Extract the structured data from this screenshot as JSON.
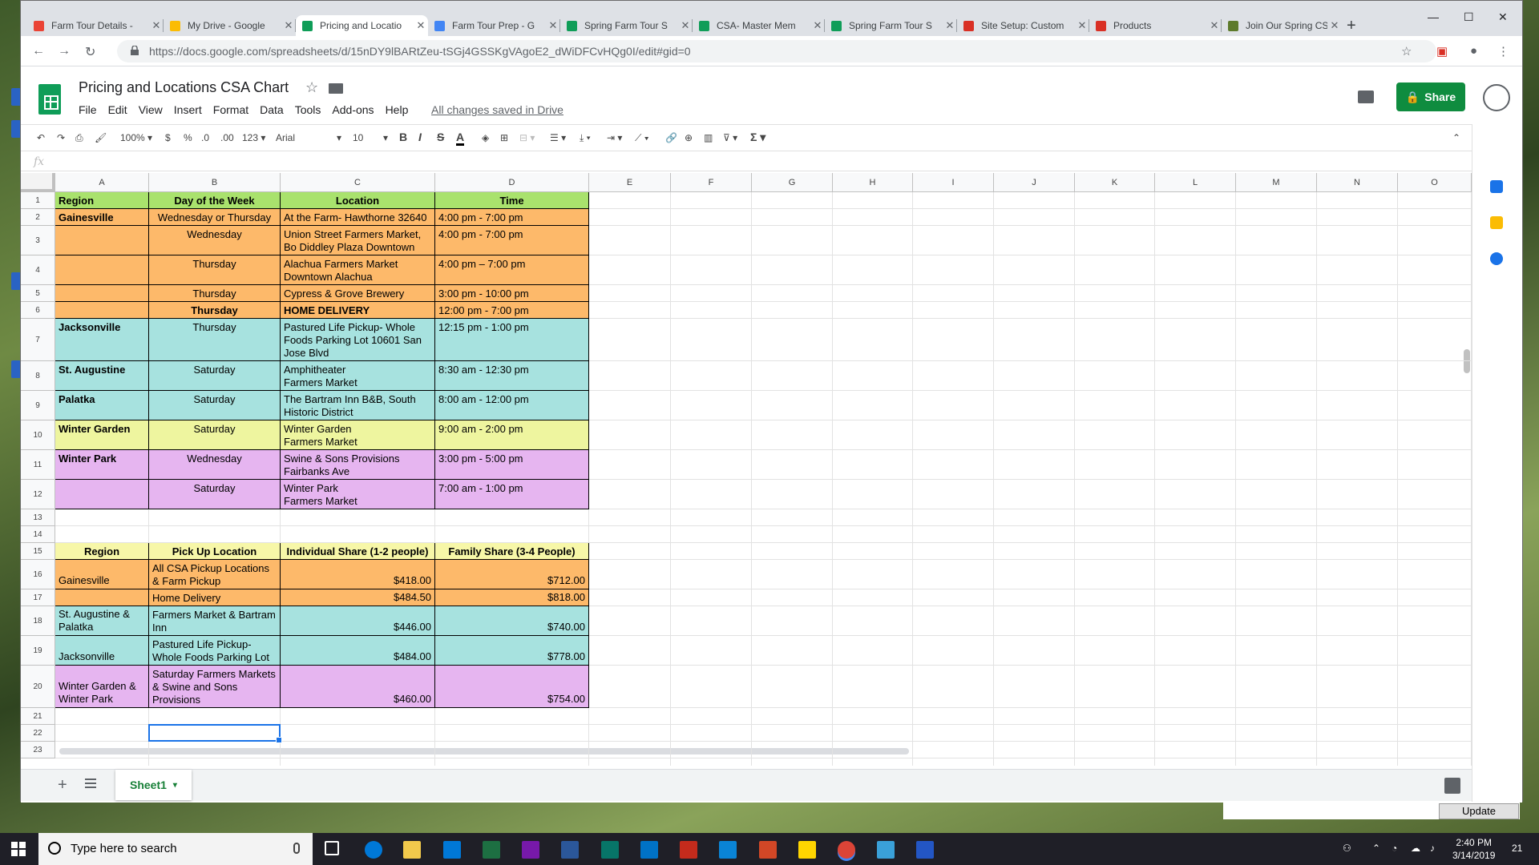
{
  "browser": {
    "tabs": [
      {
        "label": "Farm Tour Details - ",
        "icon_color": "#ea4335",
        "left": 0
      },
      {
        "label": "My Drive - Google",
        "icon_color": "#fbbc04"
      },
      {
        "label": "Pricing and Locatio",
        "icon_color": "#0f9d58",
        "active": true
      },
      {
        "label": "Farm Tour Prep - G",
        "icon_color": "#4285f4"
      },
      {
        "label": "Spring Farm Tour S",
        "icon_color": "#0f9d58"
      },
      {
        "label": "CSA- Master Mem",
        "icon_color": "#0f9d58"
      },
      {
        "label": "Spring Farm Tour S",
        "icon_color": "#0f9d58"
      },
      {
        "label": "Site Setup: Custom",
        "icon_color": "#d93025"
      },
      {
        "label": "Products",
        "icon_color": "#d93025"
      },
      {
        "label": "Join Our Spring CS",
        "icon_color": "#5d7a2b"
      }
    ],
    "url": "https://docs.google.com/spreadsheets/d/15nDY9lBARtZeu-tSGj4GSSKgVAgoE2_dWiDFCvHQg0I/edit#gid=0"
  },
  "app": {
    "title": "Pricing and Locations CSA Chart",
    "menus": [
      "File",
      "Edit",
      "View",
      "Insert",
      "Format",
      "Data",
      "Tools",
      "Add-ons",
      "Help"
    ],
    "saved_status": "All changes saved in Drive",
    "share_label": "Share"
  },
  "toolbar": {
    "zoom": "100%",
    "currency": "$",
    "percent": "%",
    "dec_less": ".0",
    "dec_more": ".00",
    "more_formats": "123",
    "font": "Arial",
    "font_size": "10",
    "bold": "B",
    "italic": "I",
    "strike": "S",
    "text_color": "A",
    "sum": "Σ"
  },
  "formula_bar": {
    "fx": "fx"
  },
  "columns": [
    "A",
    "B",
    "C",
    "D",
    "E",
    "F",
    "G",
    "H",
    "I",
    "J",
    "K",
    "L",
    "M",
    "N",
    "O"
  ],
  "rows": [
    "1",
    "2",
    "3",
    "4",
    "5",
    "6",
    "7",
    "8",
    "9",
    "10",
    "11",
    "12",
    "13",
    "14",
    "15",
    "16",
    "17",
    "18",
    "19",
    "20",
    "21",
    "22",
    "23"
  ],
  "colors": {
    "green": "#a9e26d",
    "orange": "#fdb96a",
    "teal": "#a7e2df",
    "yellow": "#eef59f",
    "purple": "#e6b5f0",
    "light_yellow": "#f7f7a8"
  },
  "schedule_table": [
    {
      "region": "Region",
      "day": "Day of the Week",
      "location": "Location",
      "time": "Time"
    },
    {
      "region": "Gainesville",
      "day": "Wednesday or Thursday",
      "location": "At the Farm- Hawthorne 32640",
      "time": "4:00 pm - 7:00 pm"
    },
    {
      "region": "",
      "day": "Wednesday",
      "location": "Union Street Farmers Market,\nBo Diddley Plaza Downtown",
      "time": "4:00 pm - 7:00 pm"
    },
    {
      "region": "",
      "day": "Thursday",
      "location": "Alachua Farmers Market\n Downtown Alachua",
      "time": "4:00 pm – 7:00 pm"
    },
    {
      "region": "",
      "day": "Thursday",
      "location": "Cypress & Grove Brewery",
      "time": "3:00 pm - 10:00 pm"
    },
    {
      "region": "",
      "day": "Thursday",
      "location": "HOME DELIVERY",
      "time": "12:00 pm - 7:00 pm"
    },
    {
      "region": "Jacksonville",
      "day": "Thursday",
      "location": "Pastured Life Pickup- Whole\nFoods Parking Lot 10601 San\nJose Blvd",
      "time": "12:15 pm - 1:00 pm"
    },
    {
      "region": "St. Augustine",
      "day": "Saturday",
      "location": "Amphitheater\n Farmers Market",
      "time": "8:30 am - 12:30 pm"
    },
    {
      "region": "Palatka",
      "day": "Saturday",
      "location": "The Bartram Inn B&B, South\nHistoric District",
      "time": "8:00 am - 12:00 pm"
    },
    {
      "region": "Winter Garden",
      "day": "Saturday",
      "location": "Winter Garden\n Farmers Market",
      "time": "9:00 am - 2:00 pm"
    },
    {
      "region": "Winter Park",
      "day": "Wednesday",
      "location": "Swine & Sons Provisions\nFairbanks Ave",
      "time": "3:00 pm - 5:00 pm"
    },
    {
      "region": "",
      "day": "Saturday",
      "location": "Winter Park\n Farmers Market",
      "time": "7:00 am - 1:00 pm"
    }
  ],
  "pricing_table": [
    {
      "region": "Region",
      "pickup": "Pick Up Location",
      "individual": "Individual Share (1-2 people)",
      "family": "Family Share (3-4 People)"
    },
    {
      "region": "Gainesville",
      "pickup": "All CSA Pickup Locations\n& Farm Pickup",
      "individual": "$418.00",
      "family": "$712.00"
    },
    {
      "region": "",
      "pickup": "Home Delivery",
      "individual": "$484.50",
      "family": "$818.00"
    },
    {
      "region": "St. Augustine &\nPalatka",
      "pickup": "Farmers Market & Bartram\nInn",
      "individual": "$446.00",
      "family": "$740.00"
    },
    {
      "region": "Jacksonville",
      "pickup": "Pastured Life Pickup-\nWhole Foods Parking Lot",
      "individual": "$484.00",
      "family": "$778.00"
    },
    {
      "region": "Winter Garden &\nWinter Park",
      "pickup": "Saturday Farmers Markets\n& Swine and Sons\nProvisions",
      "individual": "$460.00",
      "family": "$754.00"
    }
  ],
  "sheet_tab": "Sheet1",
  "update_label": "Update",
  "taskbar": {
    "search_placeholder": "Type here to search",
    "time": "2:40 PM",
    "date": "3/14/2019",
    "notifications": "21"
  }
}
